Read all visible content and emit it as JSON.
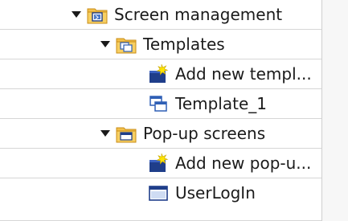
{
  "tree": {
    "items": [
      {
        "label": "Screen management",
        "icon": "screen-management-folder-icon",
        "expanded": true
      },
      {
        "label": "Templates",
        "icon": "templates-folder-icon",
        "expanded": true
      },
      {
        "label": "Add new templ...",
        "icon": "add-new-template-icon"
      },
      {
        "label": "Template_1",
        "icon": "template-icon"
      },
      {
        "label": "Pop-up screens",
        "icon": "popup-screens-folder-icon",
        "expanded": true
      },
      {
        "label": "Add new pop-u...",
        "icon": "add-new-popup-icon"
      },
      {
        "label": "UserLogIn",
        "icon": "popup-screen-icon"
      }
    ]
  },
  "colors": {
    "folder": "#f3c04b",
    "folder_dark": "#d39b1f",
    "screen_blue": "#1f3e8a",
    "sparkle": "#ffe400",
    "grid_line": "#d6d6d6"
  }
}
